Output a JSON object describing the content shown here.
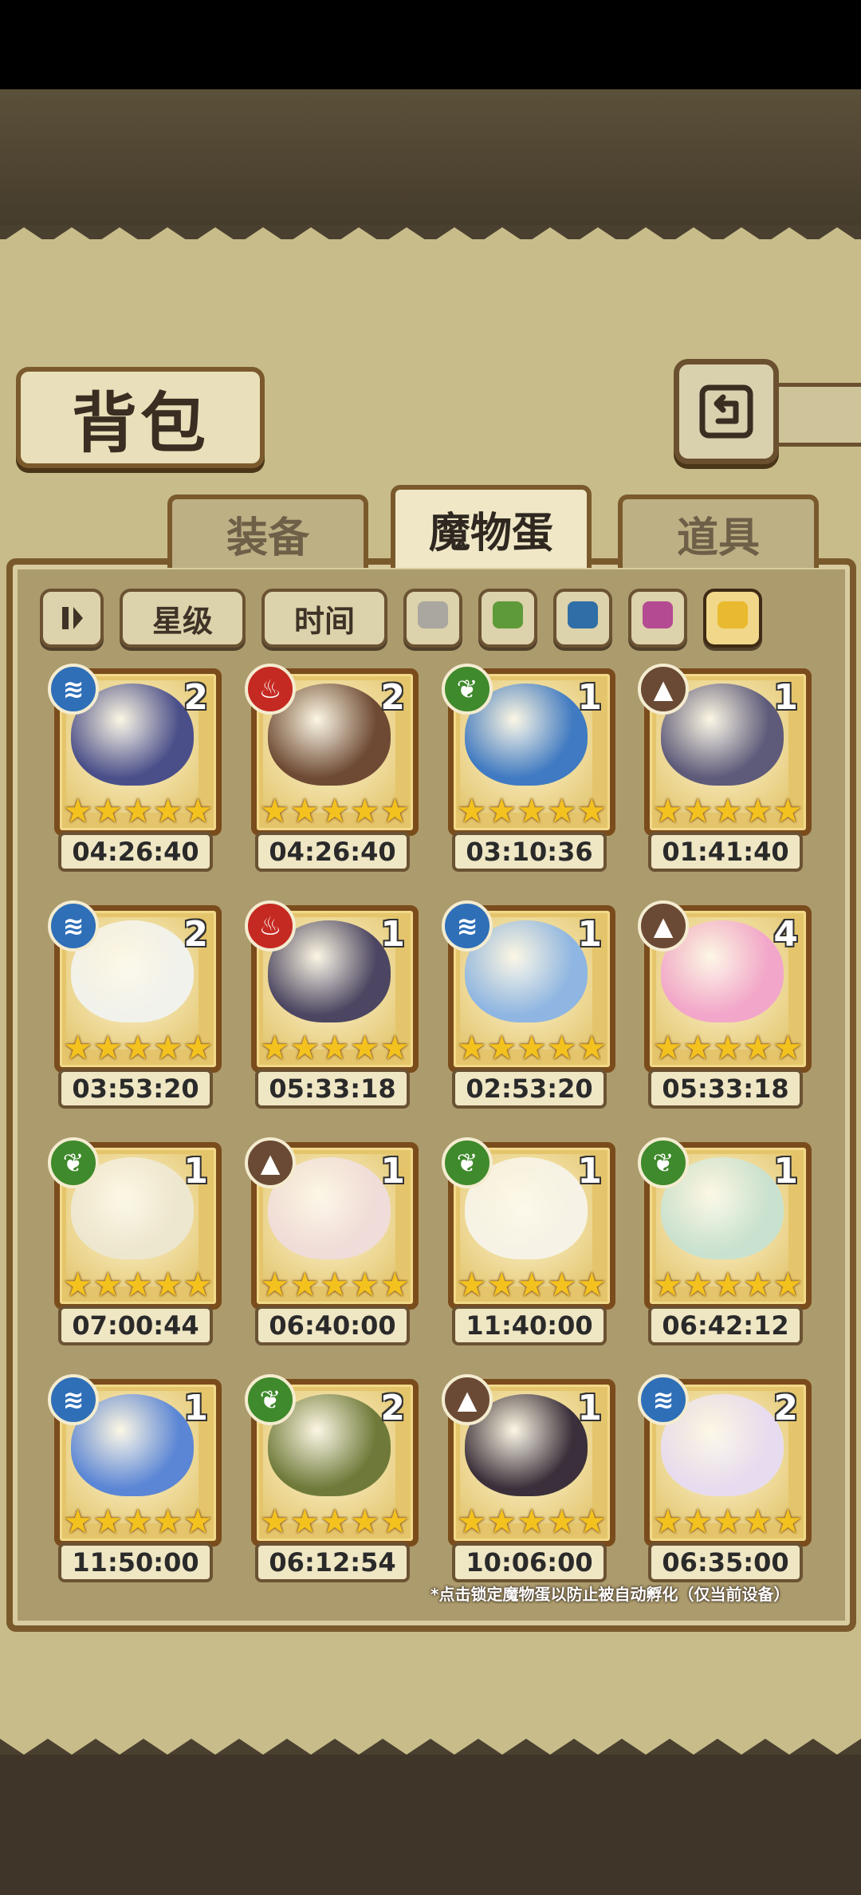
{
  "screen": {
    "title": "背包"
  },
  "tabs": [
    {
      "label": "装备",
      "active": false
    },
    {
      "label": "魔物蛋",
      "active": true
    },
    {
      "label": "道具",
      "active": false
    }
  ],
  "filters": {
    "toggle_icon": "pause-bars-icon",
    "star_label": "星级",
    "time_label": "时间",
    "color_swatches": [
      "#a9a79f",
      "#5f9a3a",
      "#2f6ea6",
      "#b44a91",
      "#e9b92f"
    ]
  },
  "element_colors": {
    "water": "#2f6fb8",
    "fire": "#c52a22",
    "nature": "#3f8a2c",
    "earth": "#6b4a35"
  },
  "eggs": [
    {
      "element": "water",
      "count": "2",
      "stars": 5,
      "timer": "04:26:40",
      "art": "dark-feather-egg",
      "color": "#4a4f8a"
    },
    {
      "element": "fire",
      "count": "2",
      "stars": 5,
      "timer": "04:26:40",
      "art": "bow-quiver-egg",
      "color": "#6e4a34"
    },
    {
      "element": "nature",
      "count": "1",
      "stars": 5,
      "timer": "03:10:36",
      "art": "fire-bird-egg",
      "color": "#3f7ac2"
    },
    {
      "element": "earth",
      "count": "1",
      "stars": 5,
      "timer": "01:41:40",
      "art": "strapped-dark-egg",
      "color": "#5d5a7a"
    },
    {
      "element": "water",
      "count": "2",
      "stars": 5,
      "timer": "03:53:20",
      "art": "white-vine-egg",
      "color": "#f2f2ec"
    },
    {
      "element": "fire",
      "count": "1",
      "stars": 5,
      "timer": "05:33:18",
      "art": "dark-wing-egg",
      "color": "#4c4662"
    },
    {
      "element": "water",
      "count": "1",
      "stars": 5,
      "timer": "02:53:20",
      "art": "heart-ribbon-egg",
      "color": "#8fb6e2"
    },
    {
      "element": "earth",
      "count": "4",
      "stars": 5,
      "timer": "05:33:18",
      "art": "pink-bunny-egg",
      "color": "#f2a6c9"
    },
    {
      "element": "nature",
      "count": "1",
      "stars": 5,
      "timer": "07:00:44",
      "art": "leaf-bud-egg",
      "color": "#eee7cf"
    },
    {
      "element": "earth",
      "count": "1",
      "stars": 5,
      "timer": "06:40:00",
      "art": "flower-nest-egg",
      "color": "#f0dcd8"
    },
    {
      "element": "nature",
      "count": "1",
      "stars": 5,
      "timer": "11:40:00",
      "art": "angel-wing-egg",
      "color": "#f6f3e6"
    },
    {
      "element": "nature",
      "count": "1",
      "stars": 5,
      "timer": "06:42:12",
      "art": "rune-egg",
      "color": "#c9e2cf"
    },
    {
      "element": "water",
      "count": "1",
      "stars": 5,
      "timer": "11:50:00",
      "art": "blue-shell-egg",
      "color": "#5b86d6"
    },
    {
      "element": "nature",
      "count": "2",
      "stars": 5,
      "timer": "06:12:54",
      "art": "butterfly-wing-egg",
      "color": "#6f7a3a"
    },
    {
      "element": "earth",
      "count": "1",
      "stars": 5,
      "timer": "10:06:00",
      "art": "coffin-egg",
      "color": "#3a2f3a"
    },
    {
      "element": "water",
      "count": "2",
      "stars": 5,
      "timer": "06:35:00",
      "art": "swirl-pearl-egg",
      "color": "#e7dcef"
    }
  ],
  "footer_note": "*点击锁定魔物蛋以防止被自动孵化（仅当前设备）"
}
